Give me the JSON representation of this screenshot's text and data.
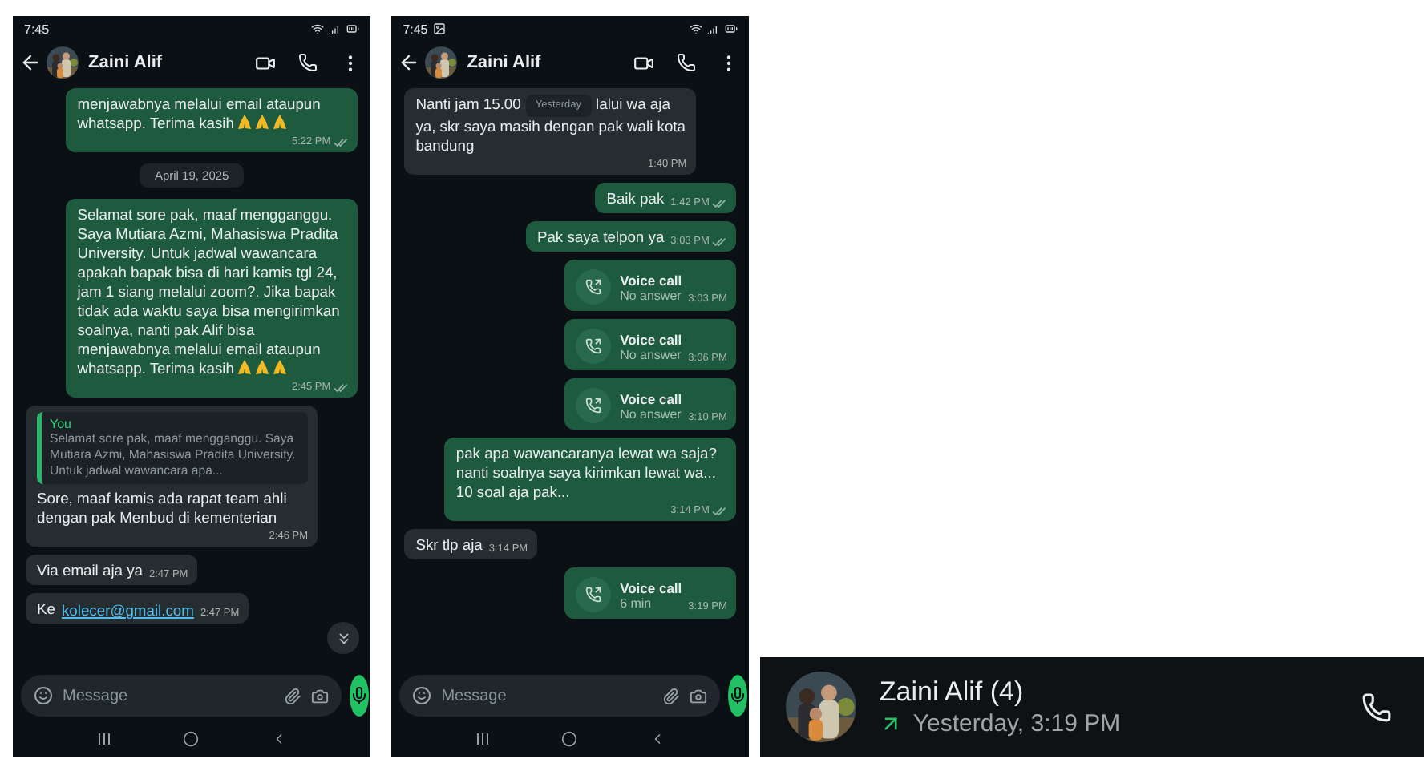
{
  "phones": [
    {
      "status_time": "7:45",
      "status_image_icon": false,
      "contact": "Zaini Alif",
      "input_placeholder": "Message",
      "scroll_down_button": true,
      "messages": [
        {
          "kind": "text",
          "outgoing": true,
          "text": "menjawabnya melalui email ataupun whatsapp. Terima kasih",
          "emoji": true,
          "time": "5:22 PM",
          "ticks": true
        },
        {
          "kind": "date",
          "text": "April 19, 2025"
        },
        {
          "kind": "text",
          "outgoing": true,
          "text": "Selamat sore pak, maaf mengganggu. Saya Mutiara Azmi, Mahasiswa Pradita University. Untuk jadwal wawancara apakah bapak bisa di hari kamis tgl 24, jam 1 siang melalui zoom?. Jika bapak tidak ada waktu saya bisa mengirimkan soalnya, nanti pak Alif bisa menjawabnya melalui email ataupun whatsapp. Terima kasih",
          "emoji": true,
          "time": "2:45 PM",
          "ticks": true
        },
        {
          "kind": "reply",
          "outgoing": false,
          "quote_author": "You",
          "quote_text": "Selamat sore pak, maaf mengganggu. Saya Mutiara Azmi, Mahasiswa Pradita University. Untuk jadwal wawancara apa...",
          "text": "Sore, maaf kamis ada rapat team ahli dengan pak Menbud di kementerian",
          "time": "2:46 PM"
        },
        {
          "kind": "text",
          "outgoing": false,
          "text": "Via email aja ya",
          "time": "2:47 PM"
        },
        {
          "kind": "link",
          "outgoing": false,
          "text": "Ke",
          "link": "kolecer@gmail.com",
          "time": "2:47 PM"
        }
      ]
    },
    {
      "status_time": "7:45",
      "status_image_icon": true,
      "contact": "Zaini Alif",
      "input_placeholder": "Message",
      "scroll_down_button": false,
      "messages": [
        {
          "kind": "text",
          "outgoing": false,
          "text": "Nanti jam 15.00",
          "chip": "Yesterday",
          "text_after": "lalui wa aja ya, skr saya masih dengan pak wali kota bandung",
          "time": "1:40 PM"
        },
        {
          "kind": "text",
          "outgoing": true,
          "text": "Baik pak",
          "time": "1:42 PM",
          "ticks": true
        },
        {
          "kind": "text",
          "outgoing": true,
          "text": "Pak saya telpon ya",
          "time": "3:03 PM",
          "ticks": true
        },
        {
          "kind": "call",
          "outgoing": true,
          "title": "Voice call",
          "detail": "No answer",
          "time": "3:03 PM"
        },
        {
          "kind": "call",
          "outgoing": true,
          "title": "Voice call",
          "detail": "No answer",
          "time": "3:06 PM"
        },
        {
          "kind": "call",
          "outgoing": true,
          "title": "Voice call",
          "detail": "No answer",
          "time": "3:10 PM"
        },
        {
          "kind": "text",
          "outgoing": true,
          "text": "pak apa wawancaranya lewat wa saja? nanti soalnya saya kirimkan lewat wa... 10 soal aja pak...",
          "time": "3:14 PM",
          "ticks": true
        },
        {
          "kind": "text",
          "outgoing": false,
          "text": "Skr tlp aja",
          "time": "3:14 PM"
        },
        {
          "kind": "call",
          "outgoing": true,
          "title": "Voice call",
          "detail": "6 min",
          "time": "3:19 PM"
        }
      ]
    }
  ],
  "call_log": {
    "name": "Zaini Alif (4)",
    "outgoing": true,
    "time": "Yesterday, 3:19 PM"
  }
}
